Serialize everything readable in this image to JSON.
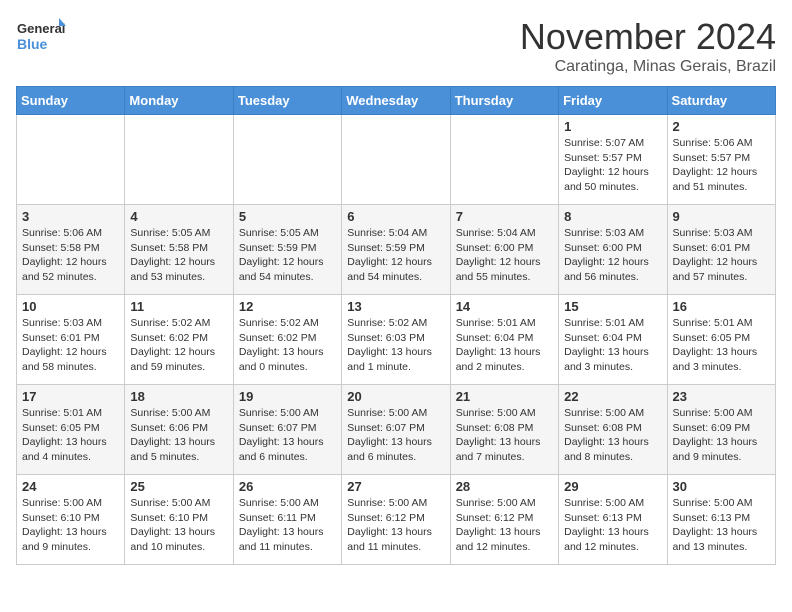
{
  "logo": {
    "line1": "General",
    "line2": "Blue"
  },
  "title": "November 2024",
  "location": "Caratinga, Minas Gerais, Brazil",
  "days_header": [
    "Sunday",
    "Monday",
    "Tuesday",
    "Wednesday",
    "Thursday",
    "Friday",
    "Saturday"
  ],
  "weeks": [
    [
      {
        "day": "",
        "info": ""
      },
      {
        "day": "",
        "info": ""
      },
      {
        "day": "",
        "info": ""
      },
      {
        "day": "",
        "info": ""
      },
      {
        "day": "",
        "info": ""
      },
      {
        "day": "1",
        "info": "Sunrise: 5:07 AM\nSunset: 5:57 PM\nDaylight: 12 hours and 50 minutes."
      },
      {
        "day": "2",
        "info": "Sunrise: 5:06 AM\nSunset: 5:57 PM\nDaylight: 12 hours and 51 minutes."
      }
    ],
    [
      {
        "day": "3",
        "info": "Sunrise: 5:06 AM\nSunset: 5:58 PM\nDaylight: 12 hours and 52 minutes."
      },
      {
        "day": "4",
        "info": "Sunrise: 5:05 AM\nSunset: 5:58 PM\nDaylight: 12 hours and 53 minutes."
      },
      {
        "day": "5",
        "info": "Sunrise: 5:05 AM\nSunset: 5:59 PM\nDaylight: 12 hours and 54 minutes."
      },
      {
        "day": "6",
        "info": "Sunrise: 5:04 AM\nSunset: 5:59 PM\nDaylight: 12 hours and 54 minutes."
      },
      {
        "day": "7",
        "info": "Sunrise: 5:04 AM\nSunset: 6:00 PM\nDaylight: 12 hours and 55 minutes."
      },
      {
        "day": "8",
        "info": "Sunrise: 5:03 AM\nSunset: 6:00 PM\nDaylight: 12 hours and 56 minutes."
      },
      {
        "day": "9",
        "info": "Sunrise: 5:03 AM\nSunset: 6:01 PM\nDaylight: 12 hours and 57 minutes."
      }
    ],
    [
      {
        "day": "10",
        "info": "Sunrise: 5:03 AM\nSunset: 6:01 PM\nDaylight: 12 hours and 58 minutes."
      },
      {
        "day": "11",
        "info": "Sunrise: 5:02 AM\nSunset: 6:02 PM\nDaylight: 12 hours and 59 minutes."
      },
      {
        "day": "12",
        "info": "Sunrise: 5:02 AM\nSunset: 6:02 PM\nDaylight: 13 hours and 0 minutes."
      },
      {
        "day": "13",
        "info": "Sunrise: 5:02 AM\nSunset: 6:03 PM\nDaylight: 13 hours and 1 minute."
      },
      {
        "day": "14",
        "info": "Sunrise: 5:01 AM\nSunset: 6:04 PM\nDaylight: 13 hours and 2 minutes."
      },
      {
        "day": "15",
        "info": "Sunrise: 5:01 AM\nSunset: 6:04 PM\nDaylight: 13 hours and 3 minutes."
      },
      {
        "day": "16",
        "info": "Sunrise: 5:01 AM\nSunset: 6:05 PM\nDaylight: 13 hours and 3 minutes."
      }
    ],
    [
      {
        "day": "17",
        "info": "Sunrise: 5:01 AM\nSunset: 6:05 PM\nDaylight: 13 hours and 4 minutes."
      },
      {
        "day": "18",
        "info": "Sunrise: 5:00 AM\nSunset: 6:06 PM\nDaylight: 13 hours and 5 minutes."
      },
      {
        "day": "19",
        "info": "Sunrise: 5:00 AM\nSunset: 6:07 PM\nDaylight: 13 hours and 6 minutes."
      },
      {
        "day": "20",
        "info": "Sunrise: 5:00 AM\nSunset: 6:07 PM\nDaylight: 13 hours and 6 minutes."
      },
      {
        "day": "21",
        "info": "Sunrise: 5:00 AM\nSunset: 6:08 PM\nDaylight: 13 hours and 7 minutes."
      },
      {
        "day": "22",
        "info": "Sunrise: 5:00 AM\nSunset: 6:08 PM\nDaylight: 13 hours and 8 minutes."
      },
      {
        "day": "23",
        "info": "Sunrise: 5:00 AM\nSunset: 6:09 PM\nDaylight: 13 hours and 9 minutes."
      }
    ],
    [
      {
        "day": "24",
        "info": "Sunrise: 5:00 AM\nSunset: 6:10 PM\nDaylight: 13 hours and 9 minutes."
      },
      {
        "day": "25",
        "info": "Sunrise: 5:00 AM\nSunset: 6:10 PM\nDaylight: 13 hours and 10 minutes."
      },
      {
        "day": "26",
        "info": "Sunrise: 5:00 AM\nSunset: 6:11 PM\nDaylight: 13 hours and 11 minutes."
      },
      {
        "day": "27",
        "info": "Sunrise: 5:00 AM\nSunset: 6:12 PM\nDaylight: 13 hours and 11 minutes."
      },
      {
        "day": "28",
        "info": "Sunrise: 5:00 AM\nSunset: 6:12 PM\nDaylight: 13 hours and 12 minutes."
      },
      {
        "day": "29",
        "info": "Sunrise: 5:00 AM\nSunset: 6:13 PM\nDaylight: 13 hours and 12 minutes."
      },
      {
        "day": "30",
        "info": "Sunrise: 5:00 AM\nSunset: 6:13 PM\nDaylight: 13 hours and 13 minutes."
      }
    ]
  ]
}
